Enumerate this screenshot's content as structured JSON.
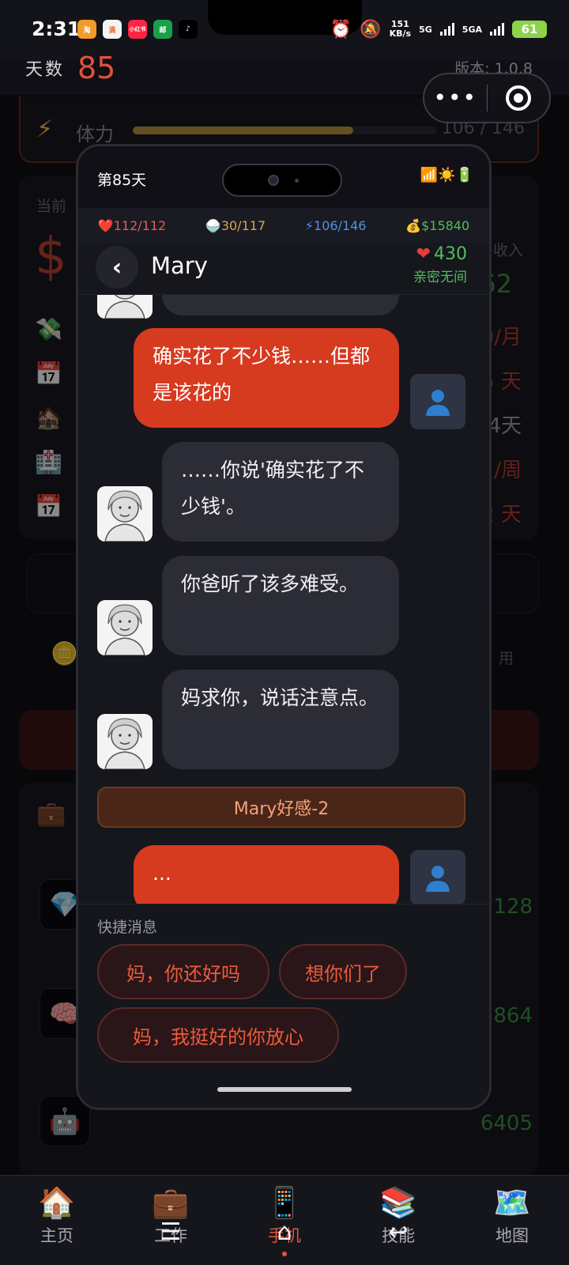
{
  "status_bar": {
    "time": "2:31",
    "apps": [
      "淘",
      "滴",
      "小红书",
      "邮",
      "♪"
    ],
    "speed_value": "151",
    "speed_unit": "KB/s",
    "net1": "5G",
    "net2": "5GA",
    "battery": "61"
  },
  "game": {
    "day_label": "天数",
    "day_value": "85",
    "version": "版本: 1.0.8",
    "stamina_label": "体力",
    "stamina_value": "106 / 146",
    "stamina_fraction": 0.726,
    "current_label": "当前",
    "dollar": "$",
    "income_label": "净收入",
    "income_value": "62",
    "rows": [
      "0/月",
      "5 天",
      "4天",
      "/周",
      "2 天"
    ],
    "use_label": "用",
    "jobs": [
      "2128",
      "864",
      "6405"
    ]
  },
  "capsule": {
    "more": "•••",
    "close": "◉"
  },
  "phone": {
    "day": "第85天",
    "status_icons": "📶☀️🔋",
    "stats": {
      "hp": "❤️112/112",
      "food": "🍚30/117",
      "energy": "⚡106/146",
      "money": "💰$15840"
    },
    "contact": {
      "back": "‹",
      "name": "Mary",
      "affection": "430",
      "level": "亲密无间"
    },
    "messages": [
      {
        "from": "in",
        "text": ""
      },
      {
        "from": "out",
        "text": "确实花了不少钱……但都是该花的"
      },
      {
        "from": "in",
        "text": "……你说'确实花了不少钱'。"
      },
      {
        "from": "in",
        "text": "你爸听了该多难受。"
      },
      {
        "from": "in",
        "text": "妈求你，说话注意点。"
      },
      {
        "from": "out",
        "text": "..."
      }
    ],
    "system_notice": "Mary好感-2",
    "quick": {
      "title": "快捷消息",
      "chips": [
        "妈，你还好吗",
        "想你们了",
        "妈，我挺好的你放心"
      ]
    }
  },
  "nav": {
    "items": [
      {
        "label": "主页",
        "icon": "🏠"
      },
      {
        "label": "工作",
        "icon": "💼"
      },
      {
        "label": "手机",
        "icon": "📱"
      },
      {
        "label": "技能",
        "icon": "📚"
      },
      {
        "label": "地图",
        "icon": "🗺️"
      }
    ],
    "active_index": 2
  },
  "colors": {
    "accent": "#d63a1f",
    "affection": "#4fbf5a",
    "background": "#0c0c12"
  }
}
